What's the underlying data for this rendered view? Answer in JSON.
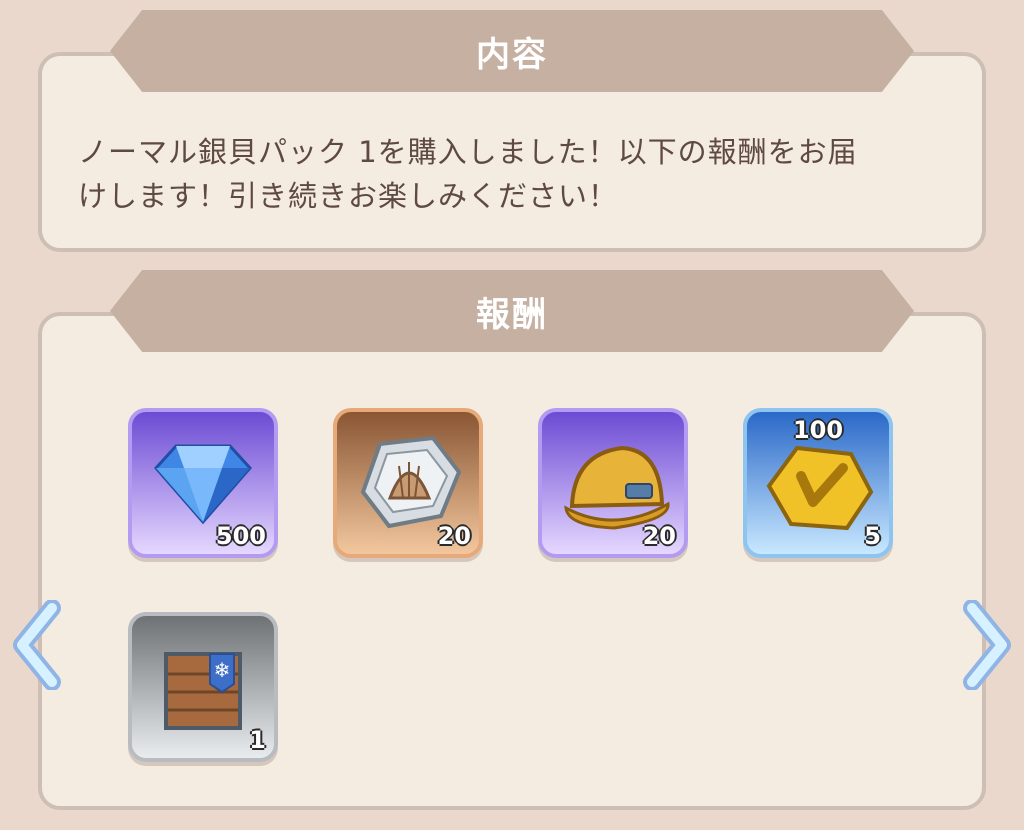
{
  "content_section": {
    "title": "内容",
    "message_line1": "ノーマル銀貝パック 1を購入しました！以下の報酬をお届",
    "message_line2": "けします！引き続きお楽しみください！"
  },
  "rewards_section": {
    "title": "報酬",
    "items": [
      {
        "name": "diamond",
        "icon": "diamond-icon",
        "quantity": "500"
      },
      {
        "name": "silver-shell",
        "icon": "shell-icon",
        "quantity": "20"
      },
      {
        "name": "helmet",
        "icon": "helmet-icon",
        "quantity": "20"
      },
      {
        "name": "gold-token",
        "icon": "gold-hex-icon",
        "top_quantity": "100",
        "quantity": "5"
      },
      {
        "name": "supply-crate",
        "icon": "crate-icon",
        "quantity": "1"
      }
    ]
  },
  "colors": {
    "background": "#ead8cc",
    "panel": "#f4ebe1",
    "banner": "#c6b0a2",
    "text": "#5e4a41"
  }
}
